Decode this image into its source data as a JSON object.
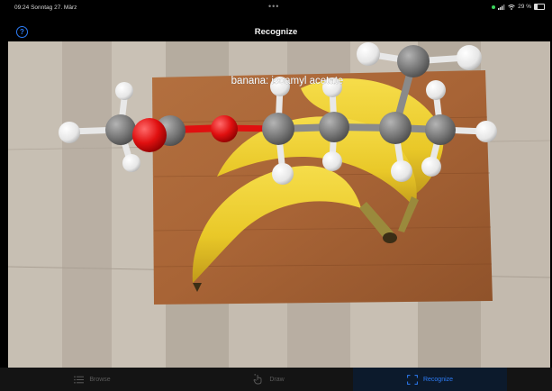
{
  "status_bar": {
    "time_date": "09:24  Sonntag 27. März",
    "battery_text": "29 %",
    "battery_level": 0.29
  },
  "nav": {
    "title": "Recognize",
    "help_icon": "question-circle-icon"
  },
  "ar_view": {
    "recognized_label": "banana: isoamyl acetate"
  },
  "tab_bar": {
    "items": [
      {
        "label": "Browse",
        "icon": "list-icon",
        "active": false
      },
      {
        "label": "Draw",
        "icon": "hand-pointer-icon",
        "active": false
      },
      {
        "label": "Recognize",
        "icon": "scan-frame-icon",
        "active": true
      }
    ]
  },
  "colors": {
    "accent": "#2d7cf6",
    "carbon": "#7d7d7d",
    "oxygen": "#e00d0d",
    "hydrogen": "#f2f2f2",
    "banana": "#f2d234"
  }
}
